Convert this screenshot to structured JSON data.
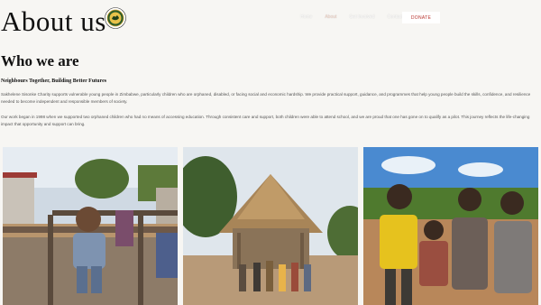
{
  "header": {
    "title": "About us",
    "nav": [
      "Home",
      "About",
      "Get Involved",
      "Contact"
    ],
    "active_nav_index": 1,
    "donate_label": "DONATE",
    "logo_icon": "charity-seal-logo"
  },
  "main": {
    "section_title": "Who we are",
    "tagline": "Neighbours Together, Building Better Futures",
    "paragraph1": "Sakhelene Sisonke Charity supports vulnerable young people in Zimbabwe, particularly children who are orphaned, disabled, or facing social and economic hardship. We provide practical support, guidance, and programmes that help young people build the skills, confidence, and resilience needed to become independent and responsible members of society.",
    "paragraph2": "Our work began in 1998 when we supported two orphaned children who had no means of accessing education. Through consistent care and support, both children were able to attend school, and we are proud that one has gone on to qualify as a pilot. This journey reflects the life-changing impact that opportunity and support can bring."
  },
  "photos": [
    {
      "name": "photo-child-on-railing"
    },
    {
      "name": "photo-thatched-hut"
    },
    {
      "name": "photo-group-of-children"
    }
  ],
  "colors": {
    "donate_text": "#b8342e",
    "background": "#f7f6f3"
  }
}
